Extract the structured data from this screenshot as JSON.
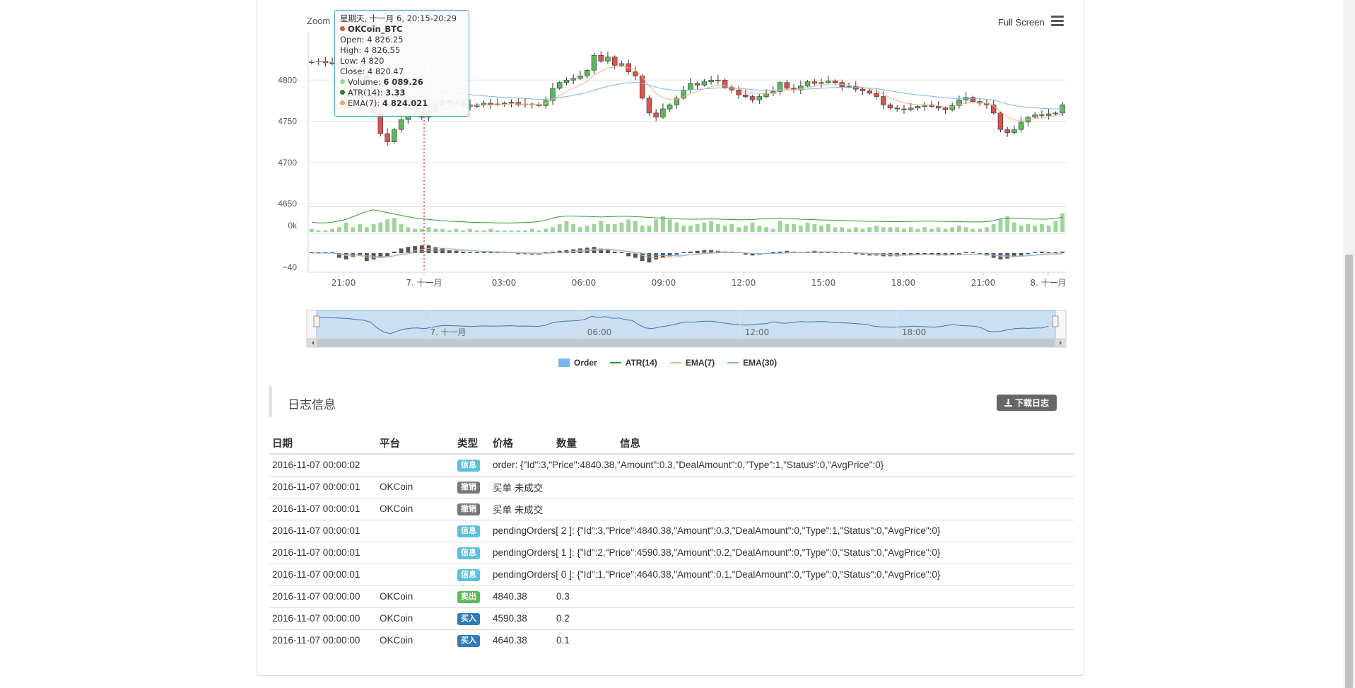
{
  "toolbar": {
    "zoom_label": "Zoom",
    "fullscreen_label": "Full Screen"
  },
  "tooltip": {
    "time": "星期天, 十一月 6, 20:15-20:29",
    "series_name": "OKCoin_BTC",
    "open": "Open: 4 826.25",
    "high": "High: 4 826.55",
    "low": "Low: 4 820",
    "close": "Close: 4 820.47",
    "volume_label": "Volume:",
    "volume_value": "6 089.26",
    "atr_label": "ATR(14):",
    "atr_value": "3.33",
    "ema_label": "EMA(7):",
    "ema_value": "4 824.021",
    "colors": {
      "series": "#d9534f",
      "volume": "#9fd49a",
      "atr": "#1a8a1a",
      "ema": "#f4a261"
    }
  },
  "legend": [
    {
      "label": "Order",
      "color": "#7cb5ec",
      "kind": "box"
    },
    {
      "label": "ATR(14)",
      "color": "#2e9b2e",
      "kind": "line"
    },
    {
      "label": "EMA(7)",
      "color": "#f4b183",
      "kind": "line"
    },
    {
      "label": "EMA(30)",
      "color": "#7cb5ec",
      "kind": "line"
    }
  ],
  "chart_data": {
    "type": "candlestick",
    "title": "",
    "y_ticks": [
      "4800",
      "4750",
      "4700",
      "4650"
    ],
    "ylim": [
      4650,
      4850
    ],
    "volume_tick": "0k",
    "indicator_tick": "−40",
    "x_ticks": [
      "21:00",
      "7. 十一月",
      "03:00",
      "06:00",
      "09:00",
      "12:00",
      "15:00",
      "18:00",
      "21:00",
      "8. 十一月"
    ],
    "navigator_ticks": [
      "7. 十一月",
      "06:00",
      "12:00",
      "18:00"
    ],
    "series": [
      {
        "name": "OKCoin_BTC",
        "kind": "candlestick",
        "up_color": "#5cb85c",
        "down_color": "#d9534f"
      },
      {
        "name": "EMA(30)",
        "kind": "line",
        "color": "#7cb5ec"
      },
      {
        "name": "EMA(7)",
        "kind": "line",
        "color": "#f4b183"
      },
      {
        "name": "Volume",
        "kind": "bar",
        "color": "#9fd49a"
      },
      {
        "name": "ATR(14)",
        "kind": "line",
        "color": "#2e9b2e"
      }
    ],
    "close": [
      4822,
      4823,
      4821,
      4820,
      4818,
      4815,
      4810,
      4806,
      4795,
      4760,
      4735,
      4725,
      4740,
      4752,
      4758,
      4760,
      4755,
      4762,
      4770,
      4775,
      4773,
      4772,
      4770,
      4768,
      4770,
      4772,
      4770,
      4771,
      4772,
      4773,
      4770,
      4771,
      4770,
      4769,
      4775,
      4790,
      4797,
      4800,
      4802,
      4805,
      4812,
      4830,
      4823,
      4828,
      4818,
      4820,
      4810,
      4805,
      4778,
      4760,
      4755,
      4765,
      4770,
      4778,
      4788,
      4796,
      4794,
      4798,
      4800,
      4800,
      4791,
      4788,
      4782,
      4780,
      4776,
      4780,
      4784,
      4786,
      4797,
      4790,
      4788,
      4793,
      4798,
      4796,
      4797,
      4799,
      4797,
      4792,
      4792,
      4789,
      4787,
      4784,
      4780,
      4770,
      4766,
      4765,
      4764,
      4766,
      4768,
      4770,
      4768,
      4766,
      4764,
      4769,
      4776,
      4779,
      4774,
      4772,
      4770,
      4760,
      4740,
      4736,
      4740,
      4749,
      4755,
      4758,
      4757,
      4759,
      4760,
      4770
    ],
    "volume": [
      2,
      1,
      1,
      2,
      3,
      6,
      3,
      5,
      3,
      5,
      6,
      8,
      9,
      5,
      3,
      2,
      2,
      3,
      2,
      2,
      1,
      2,
      1,
      2,
      1,
      1,
      2,
      1,
      1,
      1,
      1,
      1,
      2,
      1,
      2,
      3,
      5,
      7,
      5,
      3,
      4,
      5,
      7,
      5,
      5,
      6,
      8,
      7,
      4,
      4,
      8,
      10,
      8,
      6,
      4,
      4,
      5,
      6,
      7,
      5,
      4,
      5,
      3,
      4,
      6,
      4,
      3,
      2,
      7,
      5,
      5,
      4,
      6,
      5,
      4,
      5,
      3,
      3,
      2,
      3,
      2,
      3,
      4,
      3,
      3,
      3,
      2,
      3,
      2,
      3,
      2,
      3,
      2,
      3,
      4,
      3,
      2,
      2,
      3,
      5,
      8,
      10,
      6,
      4,
      5,
      4,
      5,
      4,
      7,
      12
    ],
    "atr": [
      4,
      3.5,
      3.5,
      4,
      5,
      6,
      8,
      10,
      12,
      13,
      12,
      11,
      10,
      9,
      8,
      7,
      6.5,
      6,
      5.5,
      5,
      4.8,
      4.5,
      4.3,
      4,
      3.8,
      3.7,
      3.6,
      3.5,
      3.4,
      3.5,
      3.6,
      3.8,
      4,
      4.5,
      5.5,
      7,
      8,
      8.5,
      8.5,
      8.3,
      8.2,
      8,
      7.8,
      8,
      8.2,
      8.4,
      8.3,
      8,
      7.8,
      7.5,
      7.2,
      7,
      6.8,
      6.5,
      6.3,
      6.2,
      6.2,
      6.3,
      6.4,
      6.3,
      6.1,
      6,
      5.8,
      5.8,
      6,
      6.3,
      6.5,
      6.8,
      7,
      6.8,
      6.5,
      6.2,
      6,
      5.8,
      5.6,
      5.5,
      5.3,
      5.2,
      5,
      4.9,
      4.8,
      4.7,
      4.6,
      4.5,
      4.4,
      4.4,
      4.5,
      4.6,
      4.7,
      4.8,
      4.8,
      4.7,
      4.6,
      4.5,
      4.4,
      4.3,
      4.2,
      4.2,
      4.4,
      5,
      6.5,
      7,
      7,
      6.8,
      6.5,
      6.3,
      6.2,
      6.3,
      6.8,
      7.5
    ],
    "indicator": [
      0,
      0,
      0,
      0,
      -6,
      -8,
      -5,
      -3,
      -10,
      -8,
      -6,
      -4,
      2,
      6,
      8,
      9,
      10,
      10,
      8,
      6,
      4,
      3,
      2,
      1,
      0,
      0,
      0,
      0,
      0,
      0,
      -1,
      -1,
      -2,
      -2,
      0,
      2,
      3,
      4,
      5,
      6,
      7,
      8,
      6,
      5,
      2,
      0,
      -4,
      -6,
      -10,
      -12,
      -8,
      -6,
      -4,
      -2,
      0,
      2,
      3,
      4,
      4,
      3,
      2,
      1,
      0,
      -2,
      -3,
      -2,
      -1,
      0,
      2,
      3,
      2,
      1,
      2,
      3,
      2,
      2,
      1,
      0,
      0,
      -1,
      -2,
      -3,
      -3,
      -4,
      -4,
      -4,
      -3,
      -2,
      -1,
      -1,
      -2,
      -3,
      -3,
      -2,
      -1,
      0,
      0,
      -1,
      -3,
      -6,
      -8,
      -7,
      -5,
      -3,
      -1,
      1,
      2,
      1,
      0,
      2
    ]
  },
  "log": {
    "title": "日志信息",
    "download_label": "下载日志",
    "columns": [
      "日期",
      "平台",
      "类型",
      "价格",
      "数量",
      "信息"
    ],
    "rows": [
      {
        "date": "2016-11-07 00:00:02",
        "platform": "",
        "type": "信息",
        "type_color": "#5bc0de",
        "price": "order: {\"Id\":3,\"Price\":4840.38,\"Amount\":0.3,\"DealAmount\":0,\"Type\":1,\"Status\":0,\"AvgPrice\":0}",
        "amount": "",
        "info": ""
      },
      {
        "date": "2016-11-07 00:00:01",
        "platform": "OKCoin",
        "type": "撤销",
        "type_color": "#777777",
        "price": "买单 未成交",
        "amount": "",
        "info": ""
      },
      {
        "date": "2016-11-07 00:00:01",
        "platform": "OKCoin",
        "type": "撤销",
        "type_color": "#777777",
        "price": "买单 未成交",
        "amount": "",
        "info": ""
      },
      {
        "date": "2016-11-07 00:00:01",
        "platform": "",
        "type": "信息",
        "type_color": "#5bc0de",
        "price": "pendingOrders[ 2 ]: {\"Id\":3,\"Price\":4840.38,\"Amount\":0.3,\"DealAmount\":0,\"Type\":1,\"Status\":0,\"AvgPrice\":0}",
        "amount": "",
        "info": ""
      },
      {
        "date": "2016-11-07 00:00:01",
        "platform": "",
        "type": "信息",
        "type_color": "#5bc0de",
        "price": "pendingOrders[ 1 ]: {\"Id\":2,\"Price\":4590.38,\"Amount\":0.2,\"DealAmount\":0,\"Type\":0,\"Status\":0,\"AvgPrice\":0}",
        "amount": "",
        "info": ""
      },
      {
        "date": "2016-11-07 00:00:01",
        "platform": "",
        "type": "信息",
        "type_color": "#5bc0de",
        "price": "pendingOrders[ 0 ]: {\"Id\":1,\"Price\":4640.38,\"Amount\":0.1,\"DealAmount\":0,\"Type\":0,\"Status\":0,\"AvgPrice\":0}",
        "amount": "",
        "info": ""
      },
      {
        "date": "2016-11-07 00:00:00",
        "platform": "OKCoin",
        "type": "卖出",
        "type_color": "#5cb85c",
        "price": "4840.38",
        "amount": "0.3",
        "info": ""
      },
      {
        "date": "2016-11-07 00:00:00",
        "platform": "OKCoin",
        "type": "买入",
        "type_color": "#337ab7",
        "price": "4590.38",
        "amount": "0.2",
        "info": ""
      },
      {
        "date": "2016-11-07 00:00:00",
        "platform": "OKCoin",
        "type": "买入",
        "type_color": "#337ab7",
        "price": "4640.38",
        "amount": "0.1",
        "info": ""
      }
    ]
  }
}
